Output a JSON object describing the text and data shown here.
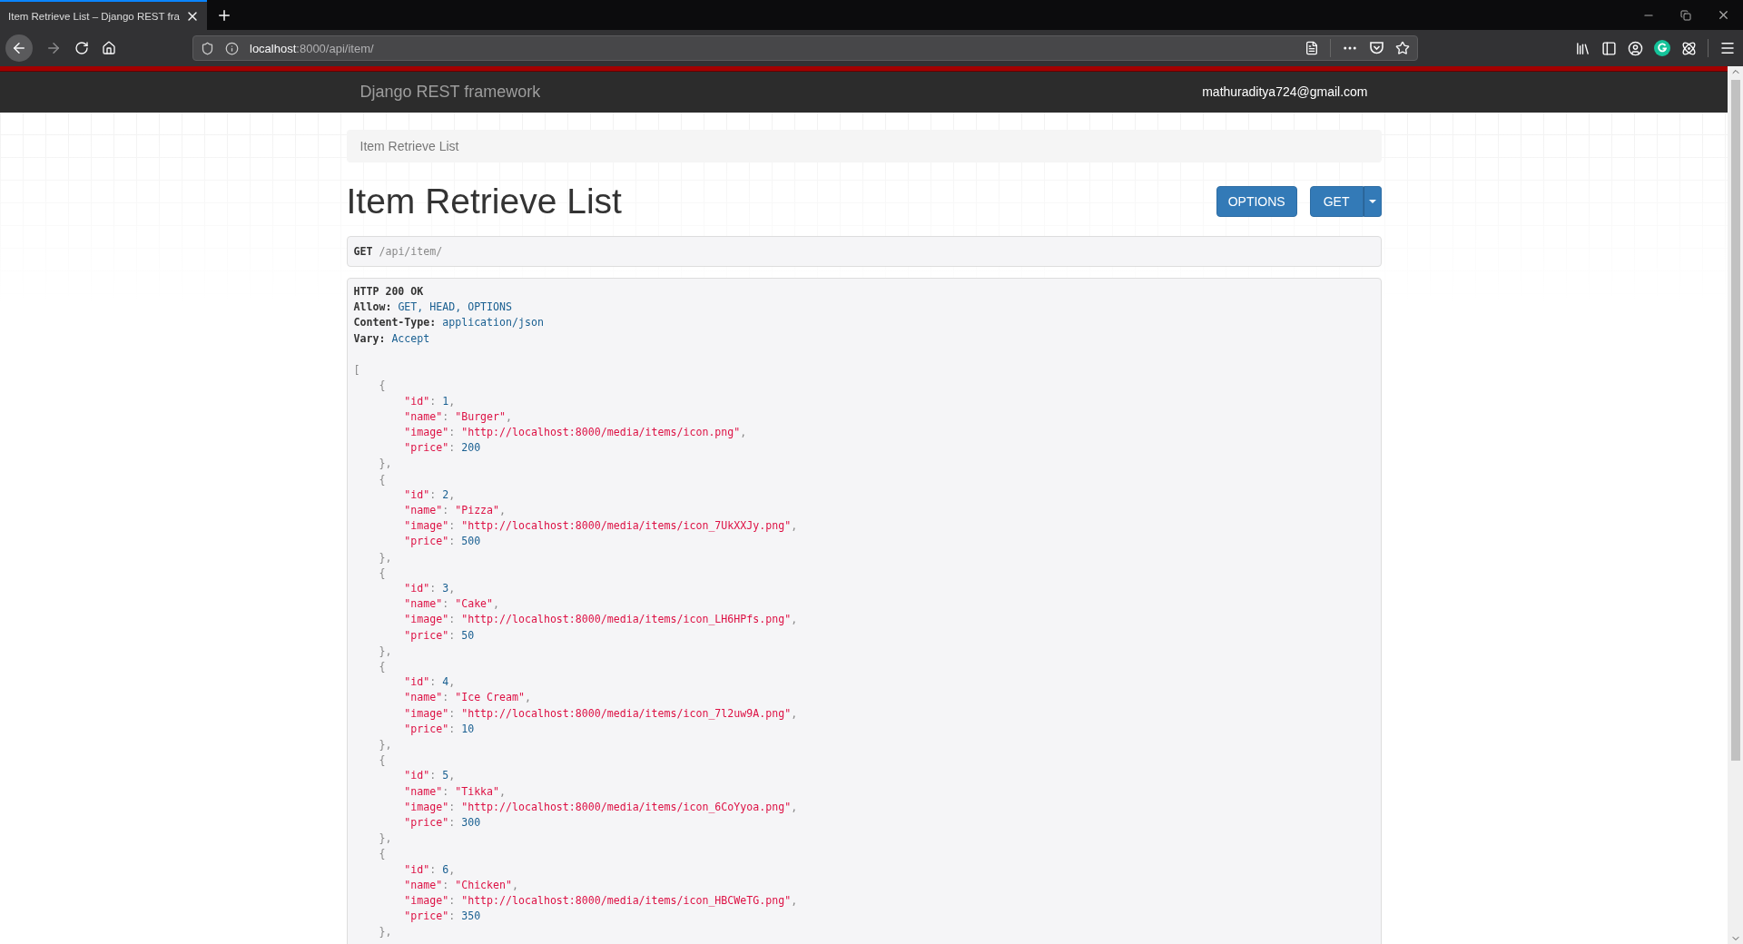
{
  "browser": {
    "tabs": [
      {
        "title": "Item Retrieve List – Django REST fra",
        "selected": true
      }
    ],
    "url": {
      "host": "localhost",
      "rest": ":8000/api/item/"
    }
  },
  "navbar": {
    "brand": "Django REST framework",
    "user": "mathuraditya724@gmail.com"
  },
  "breadcrumbs": [
    {
      "label": "Item Retrieve List",
      "selected": true
    }
  ],
  "title": "Item Retrieve List",
  "buttons": [
    {
      "label": "OPTIONS",
      "kind": "plain"
    },
    {
      "label": "GET",
      "kind": "split"
    }
  ],
  "request": {
    "method": "GET",
    "path": "/api/item/"
  },
  "response": {
    "status": "HTTP 200 OK",
    "headers": [
      {
        "name": "Allow:",
        "value": "GET, HEAD, OPTIONS"
      },
      {
        "name": "Content-Type:",
        "value": "application/json"
      },
      {
        "name": "Vary:",
        "value": "Accept"
      }
    ],
    "body": {
      "open": "[",
      "items": [
        {
          "open": "{",
          "close": "},",
          "fields": [
            {
              "key": "\"id\"",
              "sep": ":",
              "value": "1",
              "kind": "number",
              "comma": ","
            },
            {
              "key": "\"name\"",
              "sep": ":",
              "value": "\"Burger\"",
              "kind": "string",
              "comma": ","
            },
            {
              "key": "\"image\"",
              "sep": ":",
              "value": "\"http://localhost:8000/media/items/icon.png\"",
              "kind": "string",
              "comma": ","
            },
            {
              "key": "\"price\"",
              "sep": ":",
              "value": "200",
              "kind": "number"
            }
          ]
        },
        {
          "open": "{",
          "close": "},",
          "fields": [
            {
              "key": "\"id\"",
              "sep": ":",
              "value": "2",
              "kind": "number",
              "comma": ","
            },
            {
              "key": "\"name\"",
              "sep": ":",
              "value": "\"Pizza\"",
              "kind": "string",
              "comma": ","
            },
            {
              "key": "\"image\"",
              "sep": ":",
              "value": "\"http://localhost:8000/media/items/icon_7UkXXJy.png\"",
              "kind": "string",
              "comma": ","
            },
            {
              "key": "\"price\"",
              "sep": ":",
              "value": "500",
              "kind": "number"
            }
          ]
        },
        {
          "open": "{",
          "close": "},",
          "fields": [
            {
              "key": "\"id\"",
              "sep": ":",
              "value": "3",
              "kind": "number",
              "comma": ","
            },
            {
              "key": "\"name\"",
              "sep": ":",
              "value": "\"Cake\"",
              "kind": "string",
              "comma": ","
            },
            {
              "key": "\"image\"",
              "sep": ":",
              "value": "\"http://localhost:8000/media/items/icon_LH6HPfs.png\"",
              "kind": "string",
              "comma": ","
            },
            {
              "key": "\"price\"",
              "sep": ":",
              "value": "50",
              "kind": "number"
            }
          ]
        },
        {
          "open": "{",
          "close": "},",
          "fields": [
            {
              "key": "\"id\"",
              "sep": ":",
              "value": "4",
              "kind": "number",
              "comma": ","
            },
            {
              "key": "\"name\"",
              "sep": ":",
              "value": "\"Ice Cream\"",
              "kind": "string",
              "comma": ","
            },
            {
              "key": "\"image\"",
              "sep": ":",
              "value": "\"http://localhost:8000/media/items/icon_7l2uw9A.png\"",
              "kind": "string",
              "comma": ","
            },
            {
              "key": "\"price\"",
              "sep": ":",
              "value": "10",
              "kind": "number"
            }
          ]
        },
        {
          "open": "{",
          "close": "},",
          "fields": [
            {
              "key": "\"id\"",
              "sep": ":",
              "value": "5",
              "kind": "number",
              "comma": ","
            },
            {
              "key": "\"name\"",
              "sep": ":",
              "value": "\"Tikka\"",
              "kind": "string",
              "comma": ","
            },
            {
              "key": "\"image\"",
              "sep": ":",
              "value": "\"http://localhost:8000/media/items/icon_6CoYyoa.png\"",
              "kind": "string",
              "comma": ","
            },
            {
              "key": "\"price\"",
              "sep": ":",
              "value": "300",
              "kind": "number"
            }
          ]
        },
        {
          "open": "{",
          "close": "},",
          "fields": [
            {
              "key": "\"id\"",
              "sep": ":",
              "value": "6",
              "kind": "number",
              "comma": ","
            },
            {
              "key": "\"name\"",
              "sep": ":",
              "value": "\"Chicken\"",
              "kind": "string",
              "comma": ","
            },
            {
              "key": "\"image\"",
              "sep": ":",
              "value": "\"http://localhost:8000/media/items/icon_HBCWeTG.png\"",
              "kind": "string",
              "comma": ","
            },
            {
              "key": "\"price\"",
              "sep": ":",
              "value": "350",
              "kind": "number"
            }
          ]
        }
      ]
    }
  }
}
